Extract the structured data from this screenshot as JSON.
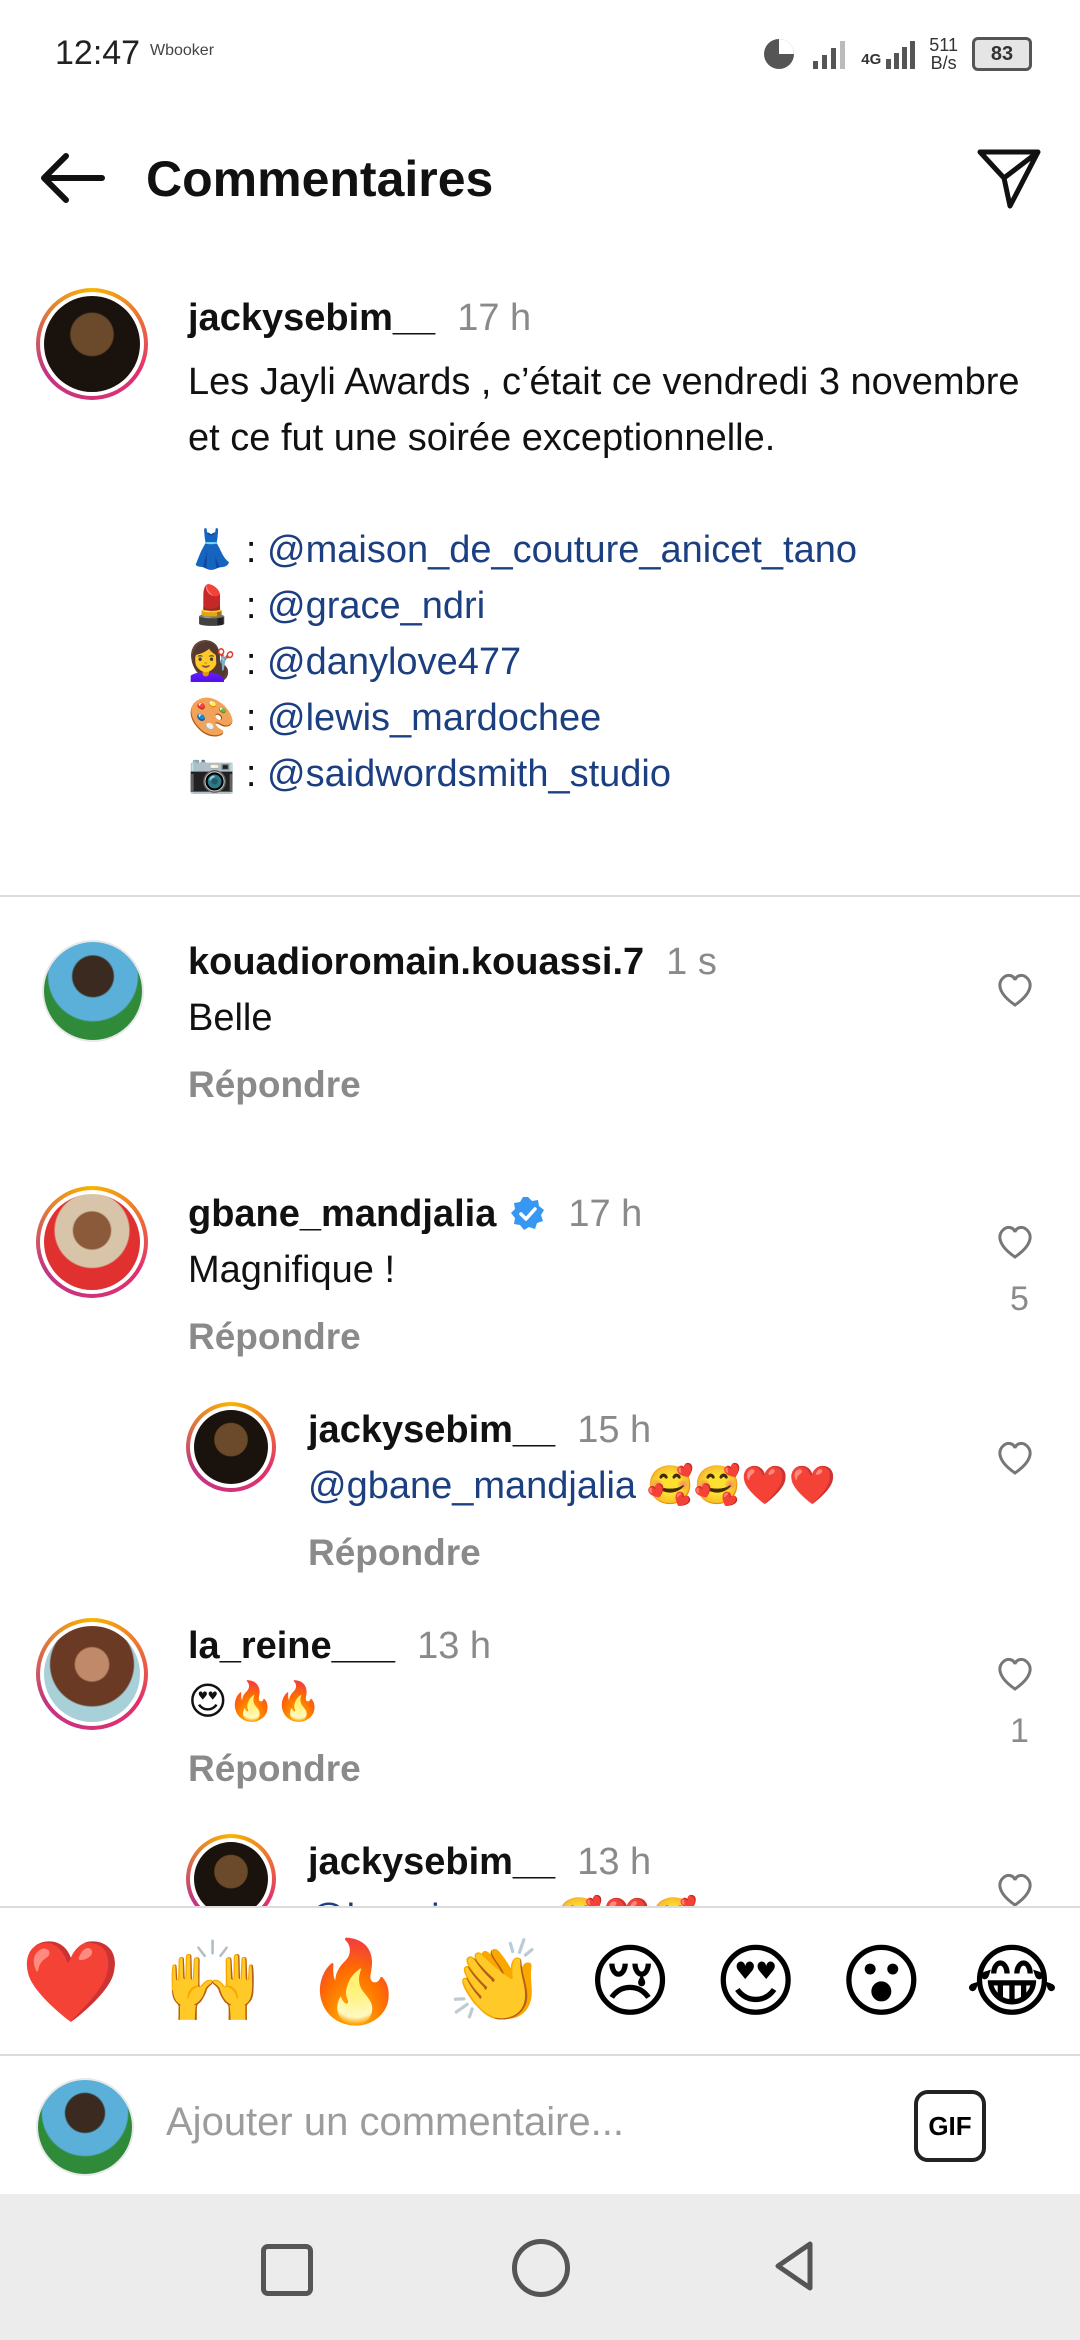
{
  "status_bar": {
    "time": "12:47",
    "mini_logo": "Wbooker",
    "network": "4G",
    "speed_value": "511",
    "speed_unit": "B/s",
    "battery": "83"
  },
  "header": {
    "title": "Commentaires",
    "back_icon": "arrow-left-icon",
    "share_icon": "paper-plane-icon"
  },
  "caption": {
    "username": "jackysebim__",
    "time": "17 h",
    "text": "Les Jayli Awards , c’était ce vendredi 3 novembre et ce fut une soirée exceptionnelle.",
    "credits": [
      {
        "emoji": "👗",
        "sep": " : ",
        "mention": "@maison_de_couture_anicet_tano"
      },
      {
        "emoji": "💄",
        "sep": " : ",
        "mention": "@grace_ndri"
      },
      {
        "emoji": "💇‍♀️",
        "sep": " : ",
        "mention": "@danylove477"
      },
      {
        "emoji": "🎨",
        "sep": " : ",
        "mention": "@lewis_mardochee"
      },
      {
        "emoji": "📷",
        "sep": "  : ",
        "mention": "@saidwordsmith_studio"
      }
    ]
  },
  "comments": [
    {
      "username": "kouadioromain.kouassi.7",
      "time": "1 s",
      "text": "Belle",
      "reply": "Répondre"
    },
    {
      "username": "gbane_mandjalia",
      "time": "17 h",
      "text": "Magnifique !",
      "reply": "Répondre",
      "likes": "5"
    },
    {
      "username": "jackysebim__",
      "time": "15 h",
      "mention": "@gbane_mandjalia",
      "emojis": " 🥰🥰❤️❤️",
      "reply": "Répondre"
    },
    {
      "username": "la_reine___",
      "time": "13 h",
      "text": "😍🔥🔥",
      "reply": "Répondre",
      "likes": "1"
    },
    {
      "username": "jackysebim__",
      "time": "13 h",
      "text": "@la_reine___ 🥰❤️🥰"
    }
  ],
  "quick_reactions": [
    "❤️",
    "🙌",
    "🔥",
    "👏",
    "😢",
    "😍",
    "😮",
    "😂"
  ],
  "composer": {
    "placeholder": "Ajouter un commentaire...",
    "gif_label": "GIF"
  },
  "colors": {
    "mention": "#1b3f80",
    "muted": "#8a8a8a",
    "verified": "#3897f0"
  }
}
